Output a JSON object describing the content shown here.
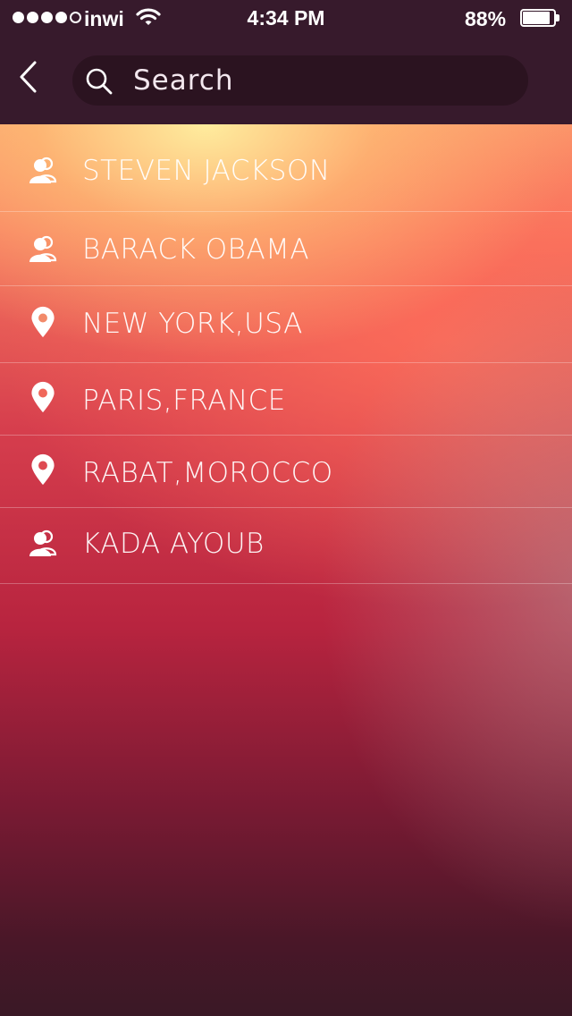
{
  "status_bar": {
    "carrier": "inwi",
    "time": "4:34 PM",
    "battery_percent": "88%",
    "signal_bars_filled": 4,
    "signal_bars_total": 5,
    "battery_level": 0.88
  },
  "nav": {
    "back_icon": "chevron-left-icon",
    "search": {
      "placeholder": "Search",
      "value": "",
      "icon": "search-icon"
    }
  },
  "results": [
    {
      "label": "STEVEN JACKSON",
      "icon": "person-icon"
    },
    {
      "label": "BARACK OBAMA",
      "icon": "person-icon"
    },
    {
      "label": "NEW YORK,USA",
      "icon": "location-pin-icon"
    },
    {
      "label": "PARIS,FRANCE",
      "icon": "location-pin-icon"
    },
    {
      "label": "RABAT,MOROCCO",
      "icon": "location-pin-icon"
    },
    {
      "label": "KADA AYOUB",
      "icon": "person-icon"
    }
  ],
  "colors": {
    "bar_background": "#371a2c",
    "search_background": "#2b1320",
    "text": "#ffffff"
  }
}
